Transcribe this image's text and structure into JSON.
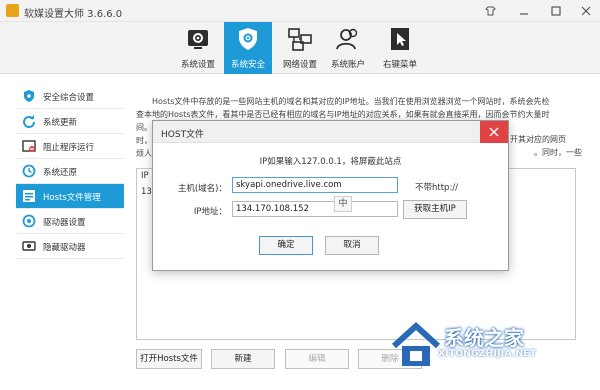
{
  "window": {
    "title": "软媒设置大师 3.6.6.0",
    "controls": [
      "skin-icon",
      "minimize-icon",
      "maximize-icon",
      "close-icon"
    ]
  },
  "toolbar": {
    "tabs": [
      {
        "label": "系统设置",
        "icon": "gear-icon",
        "active": false
      },
      {
        "label": "系统安全",
        "icon": "shield-gear-icon",
        "active": true
      },
      {
        "label": "网络设置",
        "icon": "network-icon",
        "active": false
      },
      {
        "label": "系统账户",
        "icon": "users-icon",
        "active": false
      },
      {
        "label": "右键菜单",
        "icon": "cursor-icon",
        "active": false
      }
    ]
  },
  "sidebar": {
    "items": [
      {
        "label": "安全综合设置",
        "icon": "shield-icon",
        "active": false
      },
      {
        "label": "系统更新",
        "icon": "refresh-icon",
        "active": false
      },
      {
        "label": "阻止程序运行",
        "icon": "block-icon",
        "active": false
      },
      {
        "label": "系统还原",
        "icon": "restore-icon",
        "active": false
      },
      {
        "label": "Hosts文件管理",
        "icon": "hosts-icon",
        "active": true
      },
      {
        "label": "驱动器设置",
        "icon": "drive-icon",
        "active": false
      },
      {
        "label": "隐藏驱动器",
        "icon": "hidden-drive-icon",
        "active": false
      }
    ]
  },
  "main": {
    "description_lines": [
      "　　Hosts文件中存放的是一些网站主机的域名和其对应的IP地址。当我们在使用浏览器浏览一个网站时，系统会先检",
      "查本地的Hosts表文件，看其中是否已经有相应的域名与IP地址的对应关系，如果有就会直接采用，因而会节约大量时",
      "间。",
      "时，",
      "烦人"
    ],
    "description_right_fragments": [
      "开其对应的网页",
      "。同时，一些"
    ],
    "list_header": "IP",
    "list_rows": [
      "134"
    ],
    "buttons": [
      {
        "label": "打开Hosts文件",
        "disabled": false
      },
      {
        "label": "新建",
        "disabled": false
      },
      {
        "label": "编辑",
        "disabled": true
      },
      {
        "label": "删除",
        "disabled": true
      }
    ]
  },
  "dialog": {
    "title": "HOST文件",
    "hint": "IP如果输入127.0.0.1，将屏蔽此站点",
    "host_label": "主机(域名)：",
    "host_value": "skyapi.onedrive.live.com",
    "host_note": "不带http://",
    "ip_label": "IP地址：",
    "ip_value": "134.170.108.152",
    "ime_indicator": "中",
    "get_ip_button": "获取主机IP",
    "ok_button": "确定",
    "cancel_button": "取消"
  },
  "watermark": {
    "text": "系统之家",
    "url": "XITONGZHIJIA.NET"
  },
  "colors": {
    "accent": "#1e9bd7",
    "close_red": "#e04343",
    "watermark_blue": "#2a69b8"
  }
}
